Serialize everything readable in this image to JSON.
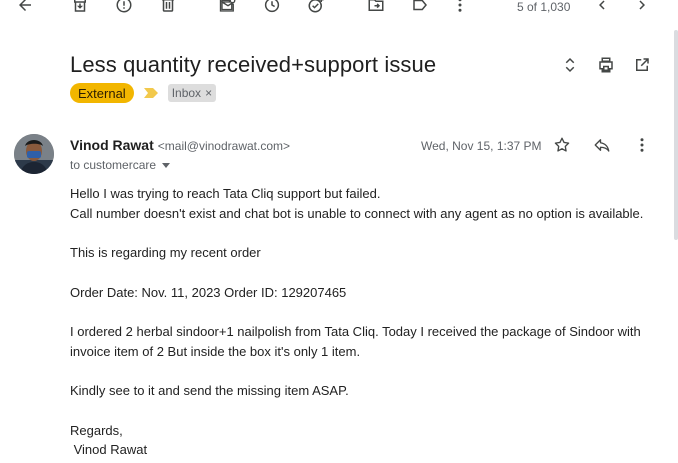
{
  "toolbar": {
    "buttons": [
      {
        "name": "back",
        "icon": "arrow-left-icon"
      },
      {
        "name": "archive",
        "icon": "archive-icon"
      },
      {
        "name": "report-spam",
        "icon": "report-spam-icon"
      },
      {
        "name": "delete",
        "icon": "trash-icon"
      },
      {
        "name": "mark-unread",
        "icon": "mark-unread-icon"
      },
      {
        "name": "snooze",
        "icon": "clock-icon"
      },
      {
        "name": "add-to-tasks",
        "icon": "add-task-icon"
      },
      {
        "name": "move-to",
        "icon": "move-to-folder-icon"
      },
      {
        "name": "label",
        "icon": "label-icon"
      },
      {
        "name": "more",
        "icon": "more-vert-icon"
      }
    ],
    "pager_text": "5 of 1,030"
  },
  "email": {
    "subject": "Less quantity received+support issue",
    "labels": {
      "external": "External",
      "inbox": "Inbox",
      "remove_symbol": "×"
    },
    "sender": {
      "name": "Vinod Rawat",
      "email": "<mail@vinodrawat.com>"
    },
    "to_text": "to customercare",
    "date": "Wed, Nov 15, 1:37 PM",
    "body_lines": {
      "l1": "Hello I was trying to reach Tata Cliq support but failed.",
      "l2": "Call number doesn't exist and chat bot is unable to connect with any agent as no option is available.",
      "l3": "This is regarding my recent order",
      "l4": "Order Date: Nov. 11, 2023 Order ID: 129207465",
      "l5": "I ordered 2 herbal sindoor+1 nailpolish from Tata Cliq. Today I received the package of Sindoor with",
      "l6": "invoice item of 2 But inside the box it's only 1 item.",
      "l7": "Kindly see to it and send the missing item ASAP.",
      "l8": "Regards,",
      "l9": " Vinod Rawat"
    }
  },
  "colors": {
    "external_chip": "#f2b600",
    "importance_marker": "#f2c94c",
    "inbox_chip": "#dddddd",
    "icon": "#444746",
    "secondary_text": "#5f6368"
  }
}
